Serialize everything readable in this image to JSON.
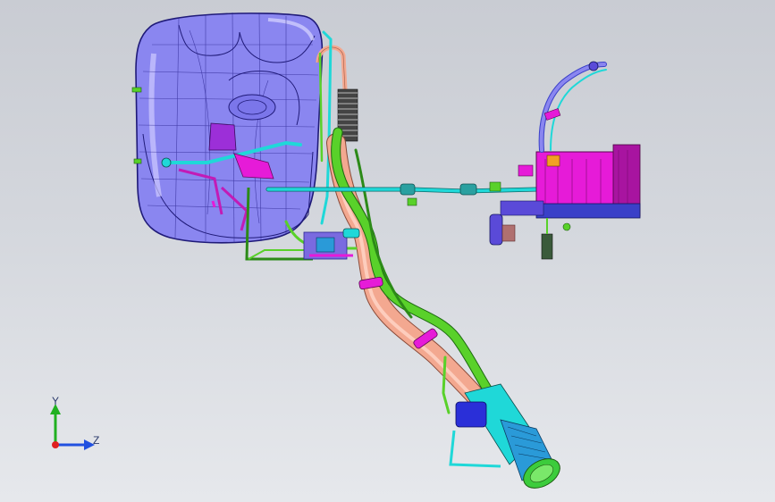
{
  "viewport": {
    "background_top": "#c9ccd3",
    "background_bottom": "#e6e8ec"
  },
  "colors": {
    "tank": "#8a86f0",
    "tank_edge": "#1f1a78",
    "filler_pipe": "#f3a890",
    "hose_green": "#59d12a",
    "line_cyan": "#1fd8d8",
    "bracket_magenta": "#e61bd8",
    "canister": "#e61bd8",
    "clamp_blue": "#2a2fd8",
    "cap_green": "#3ccc3c"
  },
  "triad": {
    "y_label": "Y",
    "z_label": "Z",
    "x_axis_color": "#e02020",
    "y_axis_color": "#20b020",
    "z_axis_color": "#2050e0"
  }
}
